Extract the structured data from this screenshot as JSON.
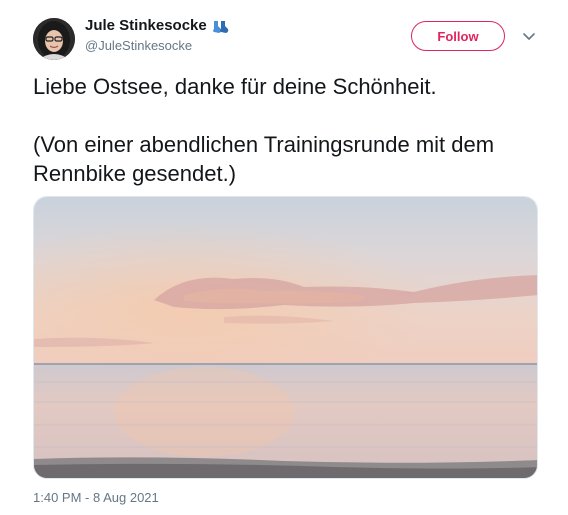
{
  "author": {
    "display_name": "Jule Stinkesocke",
    "handle": "@JuleStinkesocke",
    "emoji_icon": "socks-emoji"
  },
  "follow_label": "Follow",
  "tweet": {
    "line1": "Liebe Ostsee, danke für deine Schönheit.",
    "line2": "(Von einer abendlichen Trainingsrunde mit dem Rennbike gesendet.)"
  },
  "media": {
    "type": "photo",
    "subject": "sunset-over-baltic-sea"
  },
  "timestamp": "1:40 PM - 8 Aug 2021",
  "colors": {
    "accent": "#e0245e",
    "secondary_text": "#657786",
    "primary_text": "#14171a"
  }
}
